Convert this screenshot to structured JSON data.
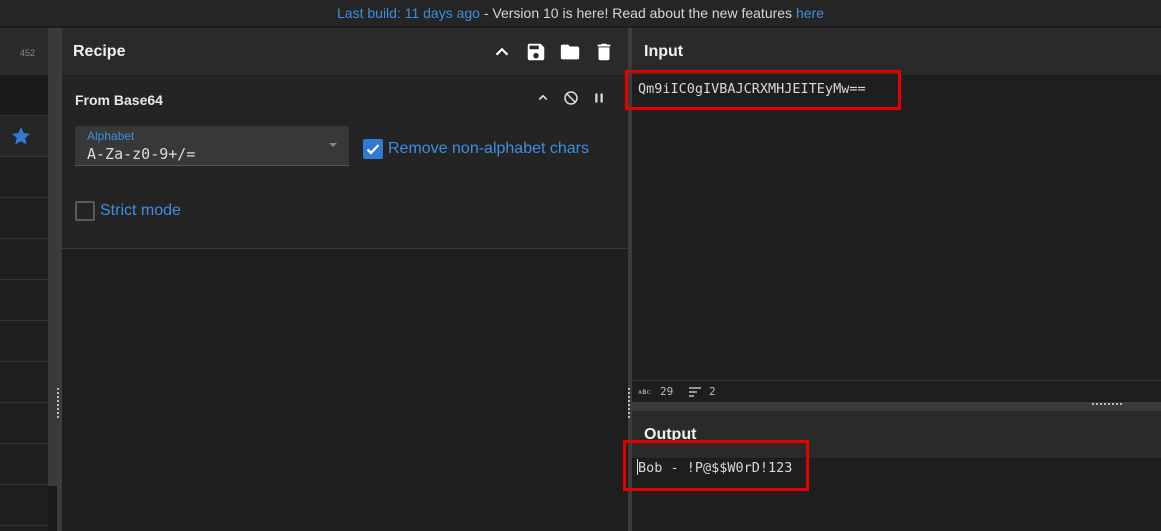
{
  "banner": {
    "last_build": "Last build: 11 days ago",
    "middle": " - Version 10 is here! Read about the new features ",
    "link": "here"
  },
  "operations": {
    "count": "452"
  },
  "recipe": {
    "title": "Recipe",
    "operation": {
      "name": "From Base64",
      "alphabet_label": "Alphabet",
      "alphabet_value": "A-Za-z0-9+/=",
      "remove_label": "Remove non-alphabet chars",
      "remove_checked": true,
      "strict_label": "Strict mode",
      "strict_checked": false
    }
  },
  "input": {
    "title": "Input",
    "text": "Qm9iIC0gIVBAJCRXMHJEITEyMw==",
    "length": "29",
    "lines": "2"
  },
  "output": {
    "title": "Output",
    "text": "Bob - !P@$$W0rD!123"
  },
  "colors": {
    "accent": "#2f7bd4",
    "link": "#3d8fe0",
    "highlight": "#e50000"
  }
}
